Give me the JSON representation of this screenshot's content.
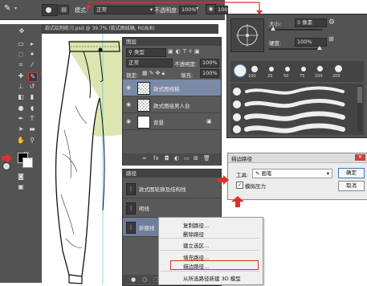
{
  "option_bar": {
    "mode_label": "模式:",
    "mode_value": "正常",
    "opacity_label": "不透明度:",
    "opacity_value": "100%",
    "flow_value": "100%"
  },
  "document_tab": {
    "title": "款式绘制练习.psd @ 39.7% (款式图线稿, RGB/8)"
  },
  "layers_panel": {
    "title": "图层",
    "kind_label": "类型",
    "blend_mode": "正常",
    "opacity_label": "不透明度:",
    "opacity_value": "100%",
    "lock_label": "锁定:",
    "fill_label": "填充:",
    "fill_value": "100%",
    "layers": [
      {
        "name": "款式图线稿",
        "selected": true
      },
      {
        "name": "款式图绘男人台",
        "selected": false
      },
      {
        "name": "背景",
        "selected": false
      }
    ],
    "footer_icons": [
      "link-icon",
      "fx-icon",
      "mask-icon",
      "adjustment-icon",
      "folder-icon",
      "new-layer-icon",
      "trash-icon"
    ]
  },
  "paths_panel": {
    "title": "路径",
    "paths": [
      {
        "name": "款式图轮廓及结构线",
        "selected": false
      },
      {
        "name": "明线",
        "selected": false
      },
      {
        "name": "折痕线",
        "selected": true
      }
    ]
  },
  "context_menu": {
    "items": [
      "复制路径...",
      "删除路径",
      "建立选区...",
      "填充路径...",
      "描边路径...",
      "从所选路径新建 3D 模型"
    ],
    "highlighted": "描边路径..."
  },
  "brush_panel": {
    "size_label": "大小:",
    "size_value": "5 像素",
    "hardness_label": "硬度:",
    "hardness_value": "100%",
    "presets": [
      "100",
      "25",
      "50",
      "75",
      "100",
      "200"
    ]
  },
  "stroke_dialog": {
    "title": "描边路径",
    "tool_label": "工具:",
    "tool_value": "画笔",
    "simulate_pressure_label": "模拟压力",
    "simulate_pressure_checked": true,
    "ok_label": "确定",
    "cancel_label": "取消"
  },
  "colors": {
    "accent_red": "#d8342b",
    "panel_bg": "#535353",
    "selection_blue": "#7a8aa6",
    "garment_fill": "#dde5b0"
  }
}
